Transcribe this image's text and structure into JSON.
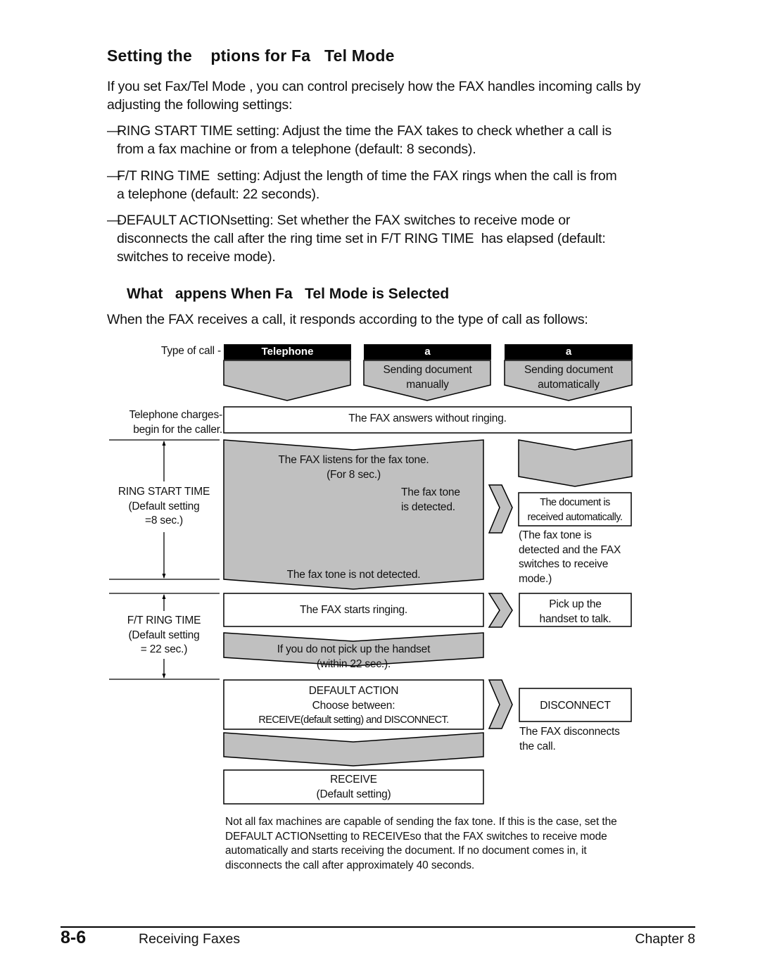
{
  "section": {
    "title": "Setting the    ptions for Fa   Tel Mode",
    "intro": "If you set Fax/Tel Mode  , you can control precisely how the FAX handles incoming calls by adjusting the following settings:",
    "bullets": [
      {
        "dash": "—",
        "text": "RING START TIME setting: Adjust the time the FAX takes to check whether a call is\nfrom a fax machine or from a telephone (default: 8 seconds)."
      },
      {
        "dash": "—",
        "text": "F/T RING TIME  setting: Adjust the length of time the FAX rings when the call is from\na telephone (default: 22 seconds)."
      },
      {
        "dash": "—",
        "text": "DEFAULT ACTIONsetting: Set whether the FAX switches to receive mode or\ndisconnects the call after the ring time set in F/T RING TIME  has elapsed (default:\nswitches to receive mode)."
      }
    ]
  },
  "subsection": {
    "title": "What   appens When Fa   Tel Mode is Selected",
    "lead": "When the FAX receives a call, it responds according to the type of call as follows:"
  },
  "diagram": {
    "type_of_call_label": "Type of call -",
    "call_types": [
      {
        "header": "Telephone",
        "desc1": "",
        "desc2": ""
      },
      {
        "header": "a",
        "desc1": "Sending document",
        "desc2": "manually"
      },
      {
        "header": "a",
        "desc1": "Sending document",
        "desc2": "automatically"
      }
    ],
    "charges_label_1": "Telephone charges-",
    "charges_label_2": "begin for the caller.",
    "answers": "The FAX answers without ringing.",
    "listens_1": "The FAX listens for the fax tone.",
    "listens_2": "(For 8 sec.)",
    "tone_detected_1": "The fax tone",
    "tone_detected_2": "is detected.",
    "tone_not_detected": "The fax tone is not detected.",
    "ring_start": {
      "name": "RING START TIME",
      "line2": "(Default setting",
      "line3": "=8 sec.)"
    },
    "doc_received_1": "The document is",
    "doc_received_2": "received automatically.",
    "doc_note": [
      "(The fax tone is",
      "detected and the FAX",
      "switches to receive",
      "mode.)"
    ],
    "starts_ringing": "The FAX starts ringing.",
    "pickup_1": "Pick up the",
    "pickup_2": "handset to talk.",
    "ft_ring": {
      "name": "F/T RING TIME",
      "line2": "(Default setting",
      "line3": "= 22 sec.)"
    },
    "no_pickup_1": "If you do not pick up the handset",
    "no_pickup_2": "(within 22 sec.).",
    "default_action_1": "DEFAULT ACTION",
    "default_action_2": "Choose between:",
    "default_action_3": "RECEIVE(default setting) and DISCONNECT.",
    "disconnect": "DISCONNECT",
    "disconnect_note_1": "The FAX disconnects",
    "disconnect_note_2": "the call.",
    "receive_1": "RECEIVE",
    "receive_2": "(Default setting)",
    "colors": {
      "fill": "#c0c0c0",
      "stroke": "#000000",
      "header": "#000000"
    }
  },
  "note": "Not all fax machines are capable of sending the fax tone. If this is the case, set the DEFAULT ACTIONsetting to RECEIVEso that the FAX switches to receive mode automatically and starts receiving the document. If no document comes in, it disconnects the call after approximately 40 seconds.",
  "footer": {
    "page": "8-6",
    "section": "Receiving Faxes",
    "chapter": "Chapter 8"
  }
}
